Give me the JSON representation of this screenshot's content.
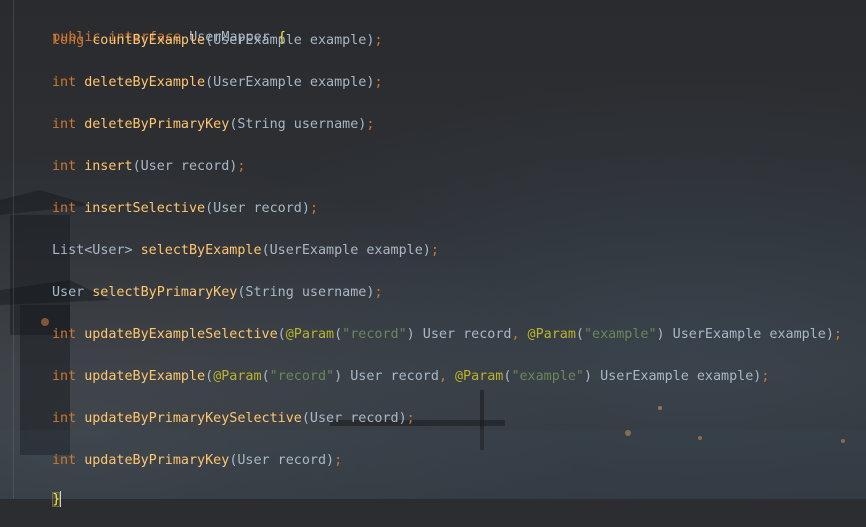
{
  "editor": {
    "header": {
      "kw1": "public",
      "kw2": "interface",
      "name": "UserMapper",
      "brace": "{"
    },
    "methods": [
      {
        "ret": "long",
        "name": "countByExample",
        "params_a": "(UserExample example)",
        "semi": ";"
      },
      {
        "ret": "int",
        "name": "deleteByExample",
        "params_a": "(UserExample example)",
        "semi": ";"
      },
      {
        "ret": "int",
        "name": "deleteByPrimaryKey",
        "params_a": "(String username)",
        "semi": ";"
      },
      {
        "ret": "int",
        "name": "insert",
        "params_a": "(User record)",
        "semi": ";"
      },
      {
        "ret": "int",
        "name": "insertSelective",
        "params_a": "(User record)",
        "semi": ";"
      },
      {
        "ret": "List<User>",
        "name": "selectByExample",
        "params_a": "(UserExample example)",
        "semi": ";"
      },
      {
        "ret": "User",
        "name": "selectByPrimaryKey",
        "params_a": "(String username)",
        "semi": ";"
      },
      {
        "ret": "int",
        "name": "updateByExampleSelective",
        "open": "(",
        "anno1": "@Param",
        "lp1": "(",
        "str1": "\"record\"",
        "rp1": ") User record",
        "comma": ",",
        "anno2": "@Param",
        "lp2": "(",
        "str2": "\"example\"",
        "rp2": ") UserExample example)",
        "semi": ";"
      },
      {
        "ret": "int",
        "name": "updateByExample",
        "open": "(",
        "anno1": "@Param",
        "lp1": "(",
        "str1": "\"record\"",
        "rp1": ") User record",
        "comma": ",",
        "anno2": "@Param",
        "lp2": "(",
        "str2": "\"example\"",
        "rp2": ") UserExample example)",
        "semi": ";"
      },
      {
        "ret": "int",
        "name": "updateByPrimaryKeySelective",
        "params_a": "(User record)",
        "semi": ";"
      },
      {
        "ret": "int",
        "name": "updateByPrimaryKey",
        "params_a": "(User record)",
        "semi": ";"
      }
    ],
    "closing_brace": "}"
  },
  "colors": {
    "keyword": "#cc7832",
    "function": "#ffc66d",
    "string": "#6a8759",
    "annotation": "#bbb529",
    "plain": "#a9b7c6",
    "brace_match": "#ffef28"
  }
}
